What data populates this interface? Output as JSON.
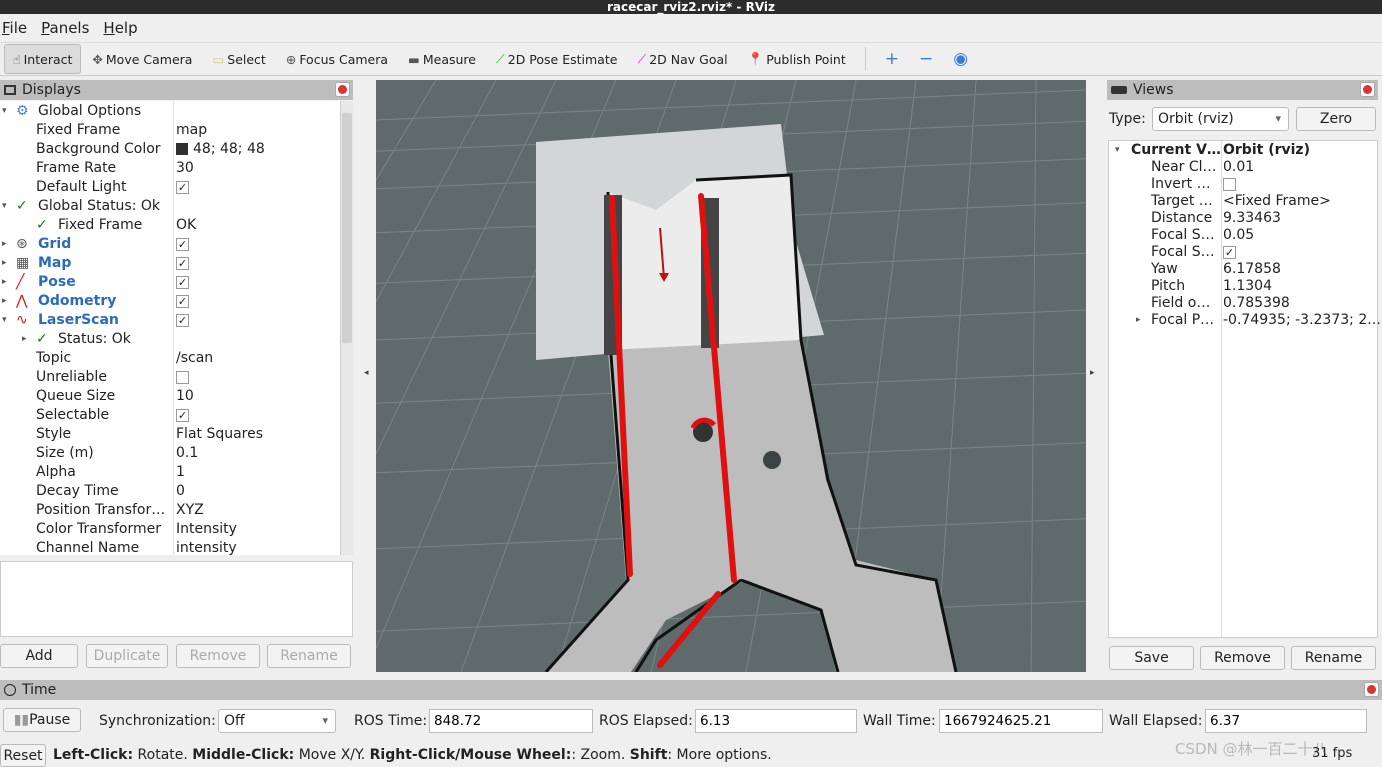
{
  "window": {
    "title": "racecar_rviz2.rviz* - RViz"
  },
  "menu": [
    "File",
    "Panels",
    "Help"
  ],
  "toolbar": {
    "tools": [
      {
        "label": "Interact",
        "icon": "hand-icon",
        "active": true
      },
      {
        "label": "Move Camera",
        "icon": "move-camera-icon"
      },
      {
        "label": "Select",
        "icon": "select-icon"
      },
      {
        "label": "Focus Camera",
        "icon": "focus-camera-icon"
      },
      {
        "label": "Measure",
        "icon": "ruler-icon"
      },
      {
        "label": "2D Pose Estimate",
        "icon": "green-arrow-icon"
      },
      {
        "label": "2D Nav Goal",
        "icon": "magenta-arrow-icon"
      },
      {
        "label": "Publish Point",
        "icon": "map-pin-icon"
      }
    ],
    "extra_icons": [
      "plus-icon",
      "minus-icon",
      "eye-icon"
    ]
  },
  "displays": {
    "title": "Displays",
    "rows": [
      {
        "k": "Global Options",
        "v": "",
        "ind": 0,
        "exp": "open",
        "icon": "gear"
      },
      {
        "k": "Fixed Frame",
        "v": "map",
        "ind": 1
      },
      {
        "k": "Background Color",
        "v": "48; 48; 48",
        "ind": 1,
        "swatch": "#303030"
      },
      {
        "k": "Frame Rate",
        "v": "30",
        "ind": 1
      },
      {
        "k": "Default Light",
        "v": "",
        "ind": 1,
        "check": true
      },
      {
        "k": "Global Status: Ok",
        "v": "",
        "ind": 0,
        "exp": "open",
        "icon": "ok"
      },
      {
        "k": "Fixed Frame",
        "v": "OK",
        "ind": 1,
        "icon": "ok"
      },
      {
        "k": "Grid",
        "v": "",
        "ind": 0,
        "exp": "closed",
        "blue": true,
        "check": true,
        "icon": "grid"
      },
      {
        "k": "Map",
        "v": "",
        "ind": 0,
        "exp": "closed",
        "blue": true,
        "check": true,
        "icon": "map"
      },
      {
        "k": "Pose",
        "v": "",
        "ind": 0,
        "exp": "closed",
        "blue": true,
        "check": true,
        "icon": "pose"
      },
      {
        "k": "Odometry",
        "v": "",
        "ind": 0,
        "exp": "closed",
        "blue": true,
        "check": true,
        "icon": "odom"
      },
      {
        "k": "LaserScan",
        "v": "",
        "ind": 0,
        "exp": "open",
        "blue": true,
        "check": true,
        "icon": "laser"
      },
      {
        "k": "Status: Ok",
        "v": "",
        "ind": 1,
        "exp": "closed",
        "icon": "ok"
      },
      {
        "k": "Topic",
        "v": "/scan",
        "ind": 1
      },
      {
        "k": "Unreliable",
        "v": "",
        "ind": 1,
        "check": false
      },
      {
        "k": "Queue Size",
        "v": "10",
        "ind": 1
      },
      {
        "k": "Selectable",
        "v": "",
        "ind": 1,
        "check": true
      },
      {
        "k": "Style",
        "v": "Flat Squares",
        "ind": 1
      },
      {
        "k": "Size (m)",
        "v": "0.1",
        "ind": 1
      },
      {
        "k": "Alpha",
        "v": "1",
        "ind": 1
      },
      {
        "k": "Decay Time",
        "v": "0",
        "ind": 1
      },
      {
        "k": "Position Transfor…",
        "v": "XYZ",
        "ind": 1
      },
      {
        "k": "Color Transformer",
        "v": "Intensity",
        "ind": 1
      },
      {
        "k": "Channel Name",
        "v": "intensity",
        "ind": 1
      }
    ],
    "buttons": [
      "Add",
      "Duplicate",
      "Remove",
      "Rename"
    ]
  },
  "views": {
    "title": "Views",
    "type_label": "Type:",
    "type_value": "Orbit (rviz)",
    "zero": "Zero",
    "rows": [
      {
        "k": "Current V…",
        "v": "Orbit (rviz)",
        "bold": true,
        "exp": "open"
      },
      {
        "k": "Near Cl…",
        "v": "0.01"
      },
      {
        "k": "Invert …",
        "v": "",
        "check": false
      },
      {
        "k": "Target …",
        "v": "<Fixed Frame>"
      },
      {
        "k": "Distance",
        "v": "9.33463"
      },
      {
        "k": "Focal S…",
        "v": "0.05"
      },
      {
        "k": "Focal S…",
        "v": "",
        "check": true
      },
      {
        "k": "Yaw",
        "v": "6.17858"
      },
      {
        "k": "Pitch",
        "v": "1.1304"
      },
      {
        "k": "Field o…",
        "v": "0.785398"
      },
      {
        "k": "Focal P…",
        "v": "-0.74935; -3.2373; 2.…",
        "exp": "closed"
      }
    ],
    "buttons": [
      "Save",
      "Remove",
      "Rename"
    ]
  },
  "time": {
    "title": "Time",
    "pause": "Pause",
    "sync_label": "Synchronization:",
    "sync_value": "Off",
    "ros_time_label": "ROS Time:",
    "ros_time": "848.72",
    "ros_elapsed_label": "ROS Elapsed:",
    "ros_elapsed": "6.13",
    "wall_time_label": "Wall Time:",
    "wall_time": "1667924625.21",
    "wall_elapsed_label": "Wall Elapsed:",
    "wall_elapsed": "6.37"
  },
  "status": {
    "reset": "Reset",
    "help_parts": [
      [
        "Left-Click:",
        true
      ],
      [
        " Rotate. ",
        false
      ],
      [
        "Middle-Click:",
        true
      ],
      [
        " Move X/Y. ",
        false
      ],
      [
        "Right-Click/Mouse Wheel:",
        true
      ],
      [
        ": Zoom. ",
        false
      ],
      [
        "Shift",
        true
      ],
      [
        ": More options.",
        false
      ]
    ],
    "fps": "31 fps",
    "watermark": "CSDN @林一百二十八"
  },
  "colors": {
    "viewport_bg": "#5f6b6b",
    "laser": "#e01010",
    "panel_header": "#bdbdbd",
    "link_blue": "#2a6bbf"
  }
}
